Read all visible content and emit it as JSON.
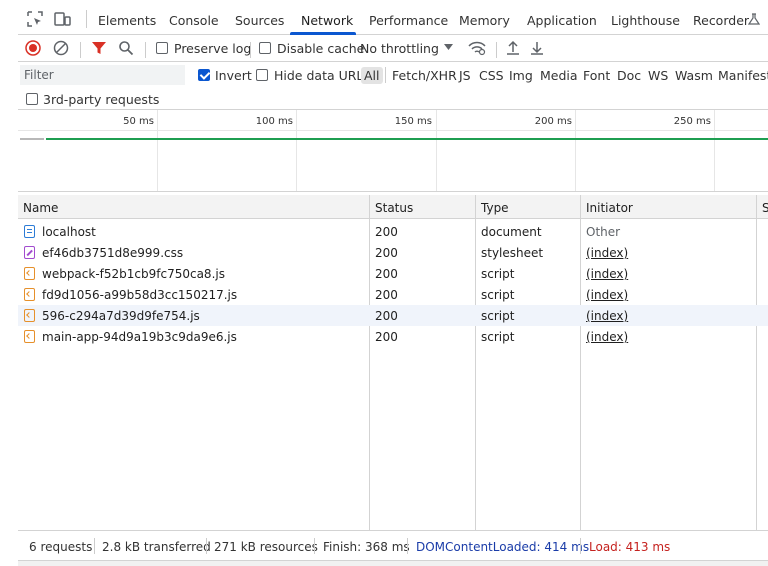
{
  "tabs": [
    {
      "label": "Elements"
    },
    {
      "label": "Console"
    },
    {
      "label": "Sources"
    },
    {
      "label": "Network",
      "active": true
    },
    {
      "label": "Performance"
    },
    {
      "label": "Memory"
    },
    {
      "label": "Application"
    },
    {
      "label": "Lighthouse"
    },
    {
      "label": "Recorder"
    }
  ],
  "toolbar": {
    "preserve_log_label": "Preserve log",
    "preserve_log_checked": false,
    "disable_cache_label": "Disable cache",
    "disable_cache_checked": false,
    "throttling_value": "No throttling"
  },
  "filter": {
    "placeholder": "Filter",
    "invert_label": "Invert",
    "invert_checked": true,
    "hide_data_urls_label": "Hide data URLs",
    "hide_data_urls_checked": false,
    "third_party_label": "3rd-party requests",
    "third_party_checked": false,
    "types": [
      "All",
      "Fetch/XHR",
      "JS",
      "CSS",
      "Img",
      "Media",
      "Font",
      "Doc",
      "WS",
      "Wasm",
      "Manifest"
    ],
    "active_type": "All"
  },
  "overview": {
    "ticks": [
      "50 ms",
      "100 ms",
      "150 ms",
      "200 ms",
      "250 ms"
    ]
  },
  "table": {
    "columns": [
      "Name",
      "Status",
      "Type",
      "Initiator",
      "S"
    ],
    "rows": [
      {
        "name": "localhost",
        "status": "200",
        "type": "document",
        "initiator": "Other",
        "icon": "document-icon"
      },
      {
        "name": "ef46db3751d8e999.css",
        "status": "200",
        "type": "stylesheet",
        "initiator": "(index)",
        "icon": "stylesheet-icon"
      },
      {
        "name": "webpack-f52b1cb9fc750ca8.js",
        "status": "200",
        "type": "script",
        "initiator": "(index)",
        "icon": "script-icon"
      },
      {
        "name": "fd9d1056-a99b58d3cc150217.js",
        "status": "200",
        "type": "script",
        "initiator": "(index)",
        "icon": "script-icon"
      },
      {
        "name": "596-c294a7d39d9fe754.js",
        "status": "200",
        "type": "script",
        "initiator": "(index)",
        "icon": "script-icon"
      },
      {
        "name": "main-app-94d9a19b3c9da9e6.js",
        "status": "200",
        "type": "script",
        "initiator": "(index)",
        "icon": "script-icon"
      }
    ]
  },
  "status_bar": {
    "requests": "6 requests",
    "transferred": "2.8 kB transferred",
    "resources": "271 kB resources",
    "finish": "Finish: 368 ms",
    "dom_content_loaded": "DOMContentLoaded: 414 ms",
    "load": "Load: 413 ms"
  },
  "colors": {
    "accent": "#0b57d0",
    "record": "#d93025",
    "filter_funnel": "#d93025",
    "timeline_green": "#1e9e51",
    "dcl_blue": "#1a3ca8",
    "load_red": "#c5221f"
  }
}
